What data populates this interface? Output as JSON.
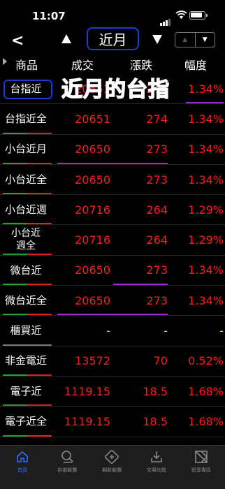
{
  "status": {
    "time": "11:07"
  },
  "nav": {
    "back": "<",
    "title": "近月",
    "seg_left": "▲",
    "seg_right": "▼"
  },
  "header": {
    "product": "商品",
    "price": "成交",
    "change": "漲跌",
    "pct": "幅度"
  },
  "overlay_caption": "近月的台指",
  "rows": [
    {
      "name": "台指近",
      "price": "20651",
      "change": "274",
      "pct": "1.34%"
    },
    {
      "name": "台指近全",
      "price": "20651",
      "change": "274",
      "pct": "1.34%"
    },
    {
      "name": "小台近月",
      "price": "20650",
      "change": "273",
      "pct": "1.34%"
    },
    {
      "name": "小台近全",
      "price": "20650",
      "change": "273",
      "pct": "1.34%"
    },
    {
      "name": "小台近週",
      "price": "20716",
      "change": "264",
      "pct": "1.29%"
    },
    {
      "name": "小台近週全",
      "name_line1": "小台近",
      "name_line2": "週全",
      "price": "20716",
      "change": "264",
      "pct": "1.29%"
    },
    {
      "name": "微台近",
      "price": "20650",
      "change": "273",
      "pct": "1.34%"
    },
    {
      "name": "微台近全",
      "price": "20650",
      "change": "273",
      "pct": "1.34%"
    },
    {
      "name": "櫃買近",
      "price": "-",
      "change": "-",
      "pct": "-"
    },
    {
      "name": "非金電近",
      "price": "13572",
      "change": "70",
      "pct": "0.52%"
    },
    {
      "name": "電子近",
      "price": "1119.15",
      "change": "18.5",
      "pct": "1.68%"
    },
    {
      "name": "電子近全",
      "price": "1119.15",
      "change": "18.5",
      "pct": "1.68%"
    }
  ],
  "tabs": [
    {
      "label": "首頁",
      "icon": "home-icon",
      "active": true
    },
    {
      "label": "自選報價",
      "icon": "watchlist-icon"
    },
    {
      "label": "期股報價",
      "icon": "quote-icon"
    },
    {
      "label": "交易功能",
      "icon": "trade-icon"
    },
    {
      "label": "凱基專區",
      "icon": "brand-icon"
    }
  ],
  "colors": {
    "up": "#ff1a1a",
    "accent": "#2f6bff",
    "highlight_box": "#1a3bd6",
    "neutral": "#ffd400"
  }
}
